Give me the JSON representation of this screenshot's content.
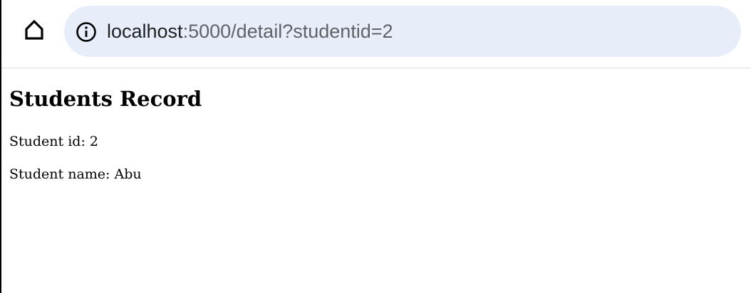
{
  "browser": {
    "home_icon": "home-icon",
    "info_icon": "info-icon",
    "url_host": "localhost",
    "url_path": ":5000/detail?studentid=2"
  },
  "page": {
    "title": "Students Record",
    "student_id_label": "Student id:",
    "student_id_value": "2",
    "student_name_label": "Student name:",
    "student_name_value": "Abu"
  },
  "colors": {
    "omnibox_bg": "#e8eef9",
    "url_text": "#202124"
  }
}
